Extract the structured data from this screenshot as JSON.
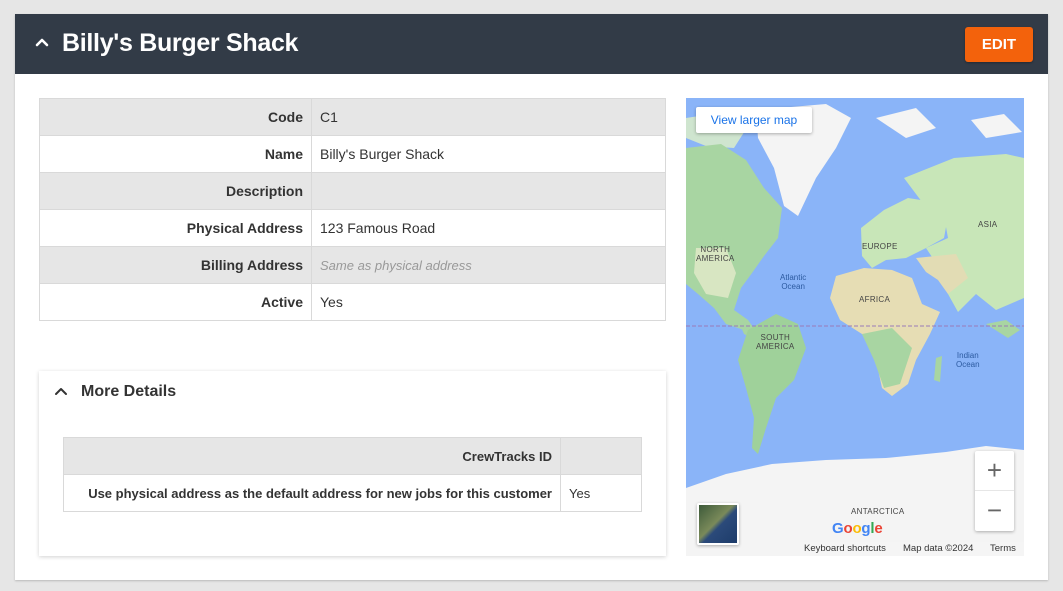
{
  "header": {
    "title": "Billy's Burger Shack",
    "edit_label": "EDIT",
    "bar_color": "#323b47",
    "accent_color": "#f3620c"
  },
  "info": {
    "rows": [
      {
        "label": "Code",
        "value": "C1"
      },
      {
        "label": "Name",
        "value": "Billy's Burger Shack"
      },
      {
        "label": "Description",
        "value": ""
      },
      {
        "label": "Physical Address",
        "value": "123 Famous Road"
      },
      {
        "label": "Billing Address",
        "value": "Same as physical address"
      },
      {
        "label": "Active",
        "value": "Yes"
      }
    ]
  },
  "more_details": {
    "title": "More Details",
    "rows": [
      {
        "label": "CrewTracks ID",
        "value": ""
      },
      {
        "label": "Use physical address as the default address for new jobs for this customer",
        "value": "Yes"
      }
    ]
  },
  "map": {
    "view_larger": "View larger map",
    "labels": {
      "north_america": [
        "NORTH",
        "AMERICA"
      ],
      "south_america": [
        "SOUTH",
        "AMERICA"
      ],
      "europe": "EUROPE",
      "africa": "AFRICA",
      "asia": "ASIA",
      "antarctica": "ANTARCTICA",
      "atlantic": [
        "Atlantic",
        "Ocean"
      ],
      "indian": [
        "Indian",
        "Ocean"
      ]
    },
    "zoom_in": "+",
    "zoom_out": "−",
    "google": "Google",
    "keyboard_shortcuts": "Keyboard shortcuts",
    "map_data": "Map data ©2024",
    "terms": "Terms"
  }
}
